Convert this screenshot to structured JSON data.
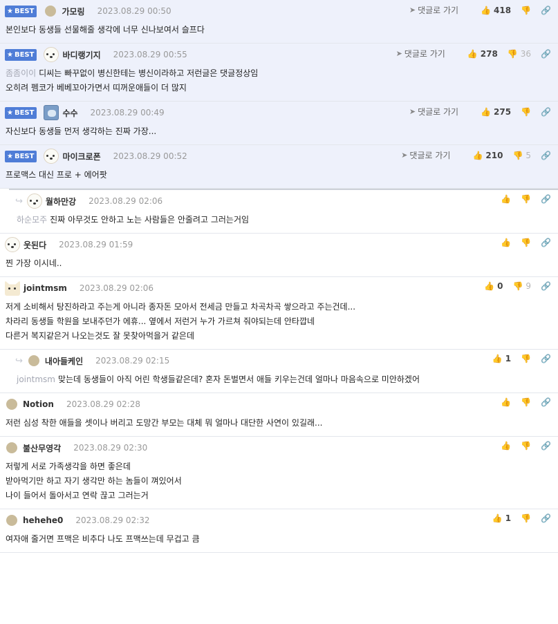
{
  "goto_label": "댓글로 가기",
  "badge_label": "BEST",
  "colors": {
    "best_bg": "#eef1fb",
    "badge": "#4f7dd7"
  },
  "comments": [
    {
      "kind": "best",
      "avatar": "plain",
      "nickname": "가모링",
      "date": "2023.08.29 00:50",
      "likes": "418",
      "dislikes": "",
      "lines": [
        "본인보다 동생들 선물해줄 생각에 너무 신나보여서 슬프다"
      ]
    },
    {
      "kind": "best",
      "avatar": "dog",
      "nickname": "바디랭기지",
      "date": "2023.08.29 00:55",
      "likes": "278",
      "dislikes": "36",
      "mention": "좀좀이이",
      "lines": [
        "디씨는 빠꾸없이 병신한테는 병신이라하고 저런글은 댓글정상임",
        "오히려 펨코가 베베꼬아가면서 띠꺼운애들이 더 많지"
      ]
    },
    {
      "kind": "best",
      "avatar": "cat",
      "nickname": "수수",
      "date": "2023.08.29 00:49",
      "likes": "275",
      "dislikes": "",
      "lines": [
        "자신보다 동생들 먼저 생각하는 진짜 가장..."
      ]
    },
    {
      "kind": "best",
      "avatar": "dog",
      "nickname": "마이크로폰",
      "date": "2023.08.29 00:52",
      "likes": "210",
      "dislikes": "5",
      "lines": [
        "프로맥스 대신 프로 + 에어팟"
      ]
    },
    {
      "kind": "reply",
      "avatar": "dog",
      "nickname": "월하만강",
      "date": "2023.08.29 02:06",
      "likes": "",
      "dislikes": "",
      "mention": "하순모주",
      "lines": [
        "진짜 아무것도 안하고 노는 사람들은 안줄려고 그러는거임"
      ]
    },
    {
      "kind": "normal",
      "avatar": "dog",
      "nickname": "웃된다",
      "date": "2023.08.29 01:59",
      "likes": "",
      "dislikes": "",
      "lines": [
        "찐 가장 이시네.."
      ]
    },
    {
      "kind": "normal",
      "avatar": "fox",
      "nickname": "jointmsm",
      "date": "2023.08.29 02:06",
      "likes": "0",
      "dislikes": "9",
      "lines": [
        "저게 소비해서 탕진하라고 주는게 아니라 종자돈 모아서 전세금 만들고 차곡차곡 쌓으라고 주는건데...",
        "차라리 동생들 학원을 보내주던가 에휴... 옆에서 저런거 누가 가르쳐 줘야되는데 안타깝네",
        "다른거 복지같은거 나오는것도 잘 못찾아먹을거 같은데"
      ]
    },
    {
      "kind": "reply",
      "avatar": "plain",
      "nickname": "내아들케인",
      "date": "2023.08.29 02:15",
      "likes": "1",
      "dislikes": "",
      "mention": "jointmsm",
      "lines": [
        "맞는데 동생들이 아직 어린 학생들같은데? 혼자 돈벌면서 애들 키우는건데 얼마나 마음속으로 미안하겠어"
      ]
    },
    {
      "kind": "normal",
      "avatar": "plain",
      "nickname": "Notion",
      "date": "2023.08.29 02:28",
      "likes": "",
      "dislikes": "",
      "lines": [
        "저런 심성 착한 애들을 셋이나 버리고 도망간 부모는 대체 뭐 얼마나 대단한 사연이 있길래..."
      ]
    },
    {
      "kind": "normal",
      "avatar": "plain",
      "nickname": "불산무영각",
      "date": "2023.08.29 02:30",
      "likes": "",
      "dislikes": "",
      "lines": [
        "저렇게 서로 가족생각을 하면 좋은데",
        "받아먹기만 하고 자기 생각만 하는 놈들이 껴있어서",
        "나이 들어서 돌아서고 연락 끊고 그러는거"
      ]
    },
    {
      "kind": "normal",
      "avatar": "plain",
      "nickname": "hehehe0",
      "date": "2023.08.29 02:32",
      "likes": "1",
      "dislikes": "",
      "lines": [
        "여자애 줄거면 프맥은 비추다 나도 프맥쓰는데 무겁고 큼"
      ]
    }
  ]
}
